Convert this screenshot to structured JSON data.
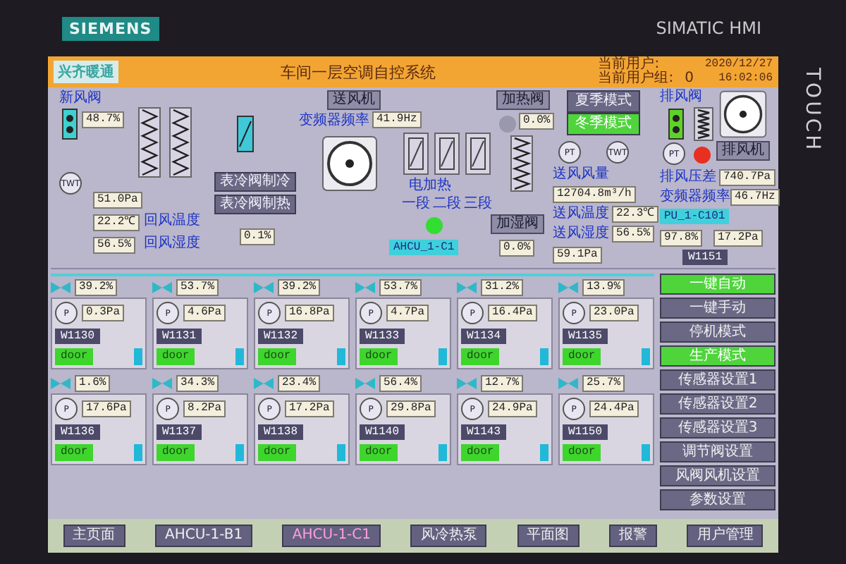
{
  "device": {
    "brand": "SIEMENS",
    "model": "SIMATIC HMI",
    "side_label": "TOUCH"
  },
  "header": {
    "logo": "兴齐暖通",
    "title": "车间一层空调自控系统",
    "user_label": "当前用户:",
    "user_group_label": "当前用户组:",
    "user_group": "0",
    "date": "2020/12/27",
    "time": "16:02:06"
  },
  "ahu": {
    "fresh_air_damper": {
      "label": "新风阀",
      "value": "48.7%"
    },
    "return_sensor": "TWT",
    "return_pressure": "51.0Pa",
    "return_temp": {
      "label": "回风温度",
      "value": "22.2℃"
    },
    "return_humidity": {
      "label": "回风湿度",
      "value": "56.5%"
    },
    "cooling_valve_buttons": [
      "表冷阀制冷",
      "表冷阀制热"
    ],
    "cooling_valve_value": "0.1%",
    "supply_fan": {
      "label": "送风机",
      "freq_label": "变频器频率",
      "freq": "41.9Hz"
    },
    "heater": {
      "label": "电加热",
      "stages": [
        "一段",
        "二段",
        "三段"
      ]
    },
    "unit": {
      "name": "AHCU_1-C1",
      "color": "#33dd33"
    },
    "heating_valve": {
      "label": "加热阀",
      "value": "0.0%",
      "color": "#9a98ac"
    },
    "humidifier_valve": {
      "label": "加湿阀",
      "value": "0.0%"
    },
    "supply_flow": {
      "sensor": "PT",
      "label": "送风风量",
      "value": "12704.8m³/h"
    },
    "supply_pressure": "59.1Pa",
    "supply_sensor": "TWT",
    "supply_temp": {
      "label": "送风温度",
      "value": "22.3℃"
    },
    "supply_humidity": {
      "label": "送风湿度",
      "value": "56.5%"
    },
    "modes": [
      {
        "label": "夏季模式",
        "selected": false
      },
      {
        "label": "冬季模式",
        "selected": true
      }
    ]
  },
  "exhaust": {
    "damper_label": "排风阀",
    "sensor": "PT",
    "pressure_label": "排风压差",
    "pressure": "740.7Pa",
    "fan_label": "排风机",
    "freq_label": "变频器频率",
    "freq": "46.7Hz",
    "unit": {
      "name": "PU_1-C101",
      "color": "#e83020"
    },
    "valve": "97.8%",
    "room_pressure": "17.2Pa",
    "room": "W1151"
  },
  "rooms": [
    {
      "valve": "39.2%",
      "sensor": "P",
      "pressure": "0.3Pa",
      "name": "W1130",
      "door": "door"
    },
    {
      "valve": "53.7%",
      "sensor": "P",
      "pressure": "4.6Pa",
      "name": "W1131",
      "door": "door"
    },
    {
      "valve": "39.2%",
      "sensor": "P",
      "pressure": "16.8Pa",
      "name": "W1132",
      "door": "door"
    },
    {
      "valve": "53.7%",
      "sensor": "P",
      "pressure": "4.7Pa",
      "name": "W1133",
      "door": "door"
    },
    {
      "valve": "31.2%",
      "sensor": "P",
      "pressure": "16.4Pa",
      "name": "W1134",
      "door": "door"
    },
    {
      "valve": "13.9%",
      "sensor": "P",
      "pressure": "23.0Pa",
      "name": "W1135",
      "door": "door"
    },
    {
      "valve": "1.6%",
      "sensor": "P",
      "pressure": "17.6Pa",
      "name": "W1136",
      "door": "door"
    },
    {
      "valve": "34.3%",
      "sensor": "P",
      "pressure": "8.2Pa",
      "name": "W1137",
      "door": "door"
    },
    {
      "valve": "23.4%",
      "sensor": "P",
      "pressure": "17.2Pa",
      "name": "W1138",
      "door": "door"
    },
    {
      "valve": "56.4%",
      "sensor": "P",
      "pressure": "29.8Pa",
      "name": "W1140",
      "door": "door"
    },
    {
      "valve": "12.7%",
      "sensor": "P",
      "pressure": "24.9Pa",
      "name": "W1143",
      "door": "door"
    },
    {
      "valve": "25.7%",
      "sensor": "P",
      "pressure": "24.4Pa",
      "name": "W1150",
      "door": "door"
    }
  ],
  "sidebar": [
    {
      "label": "一键自动",
      "on": true
    },
    {
      "label": "一键手动",
      "on": false
    },
    {
      "label": "停机模式",
      "on": false
    },
    {
      "label": "生产模式",
      "on": true
    },
    {
      "label": "传感器设置1",
      "on": false
    },
    {
      "label": "传感器设置2",
      "on": false
    },
    {
      "label": "传感器设置3",
      "on": false
    },
    {
      "label": "调节阀设置",
      "on": false
    },
    {
      "label": "风阀风机设置",
      "on": false
    },
    {
      "label": "参数设置",
      "on": false
    }
  ],
  "nav": [
    {
      "label": "主页面",
      "selected": false
    },
    {
      "label": "AHCU-1-B1",
      "selected": false
    },
    {
      "label": "AHCU-1-C1",
      "selected": true
    },
    {
      "label": "风冷热泵",
      "selected": false
    },
    {
      "label": "平面图",
      "selected": false
    },
    {
      "label": "报警",
      "selected": false
    },
    {
      "label": "用户管理",
      "selected": false
    }
  ]
}
